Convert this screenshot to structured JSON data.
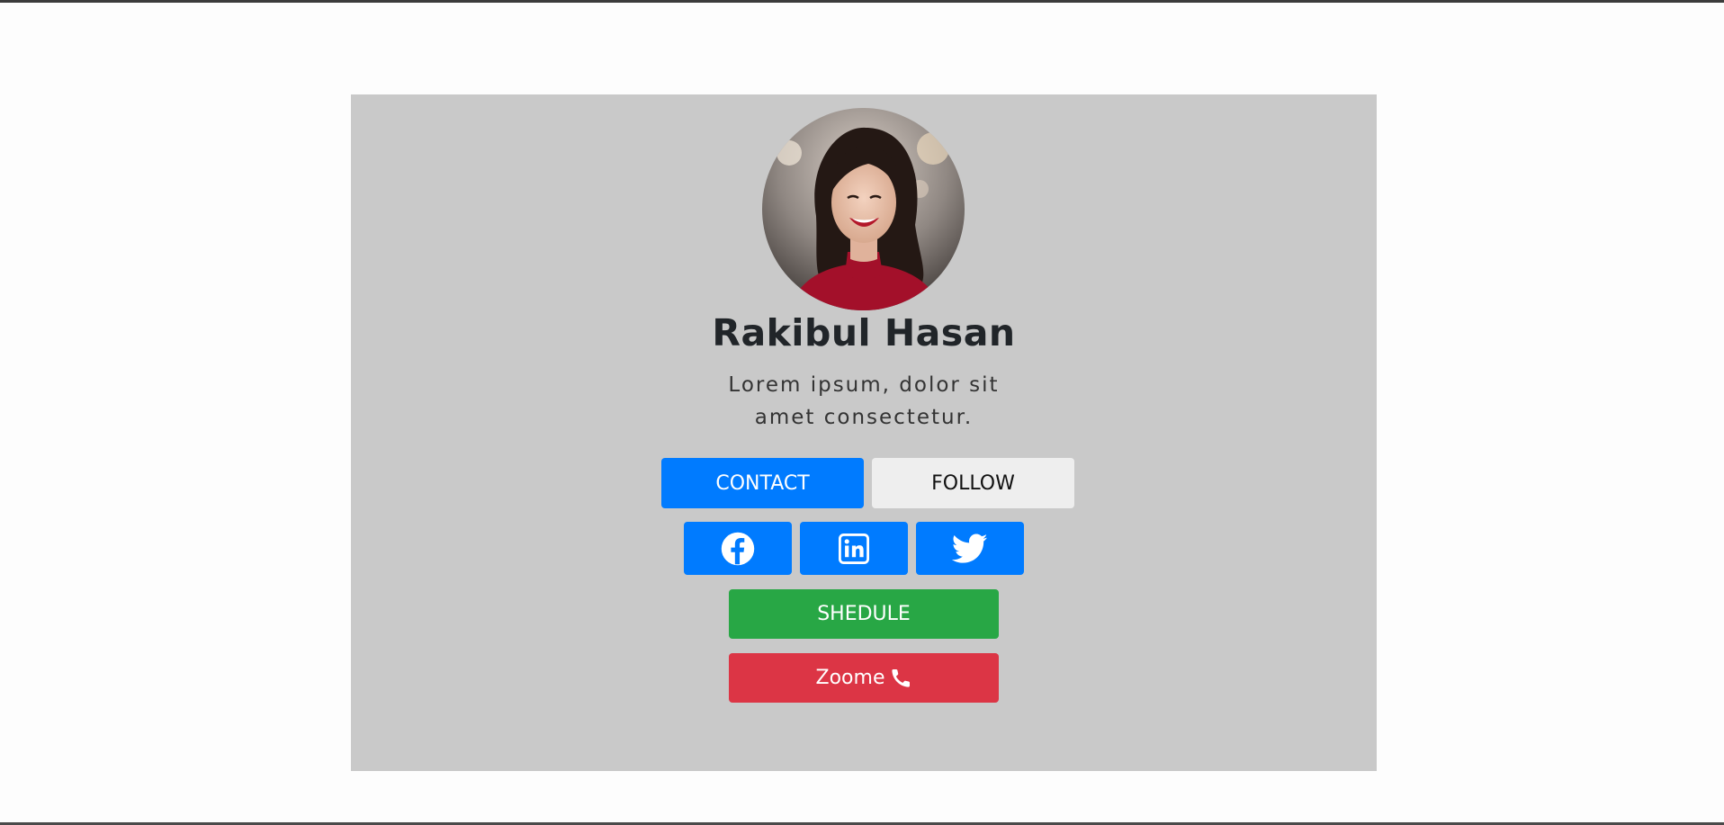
{
  "profile": {
    "name": "Rakibul Hasan",
    "bio_line1": "Lorem ipsum, dolor sit",
    "bio_line2": "amet consectetur."
  },
  "buttons": {
    "contact": "CONTACT",
    "follow": "FOLLOW",
    "shedule": "SHEDULE",
    "zoome": "Zoome"
  },
  "social": {
    "facebook_icon": "facebook-icon",
    "linkedin_icon": "linkedin-icon",
    "twitter_icon": "twitter-icon",
    "phone_icon": "phone-icon"
  },
  "colors": {
    "card_bg": "#c9c9c9",
    "primary": "#007bff",
    "light": "#eeeeee",
    "success": "#28a745",
    "danger": "#dc3545"
  }
}
